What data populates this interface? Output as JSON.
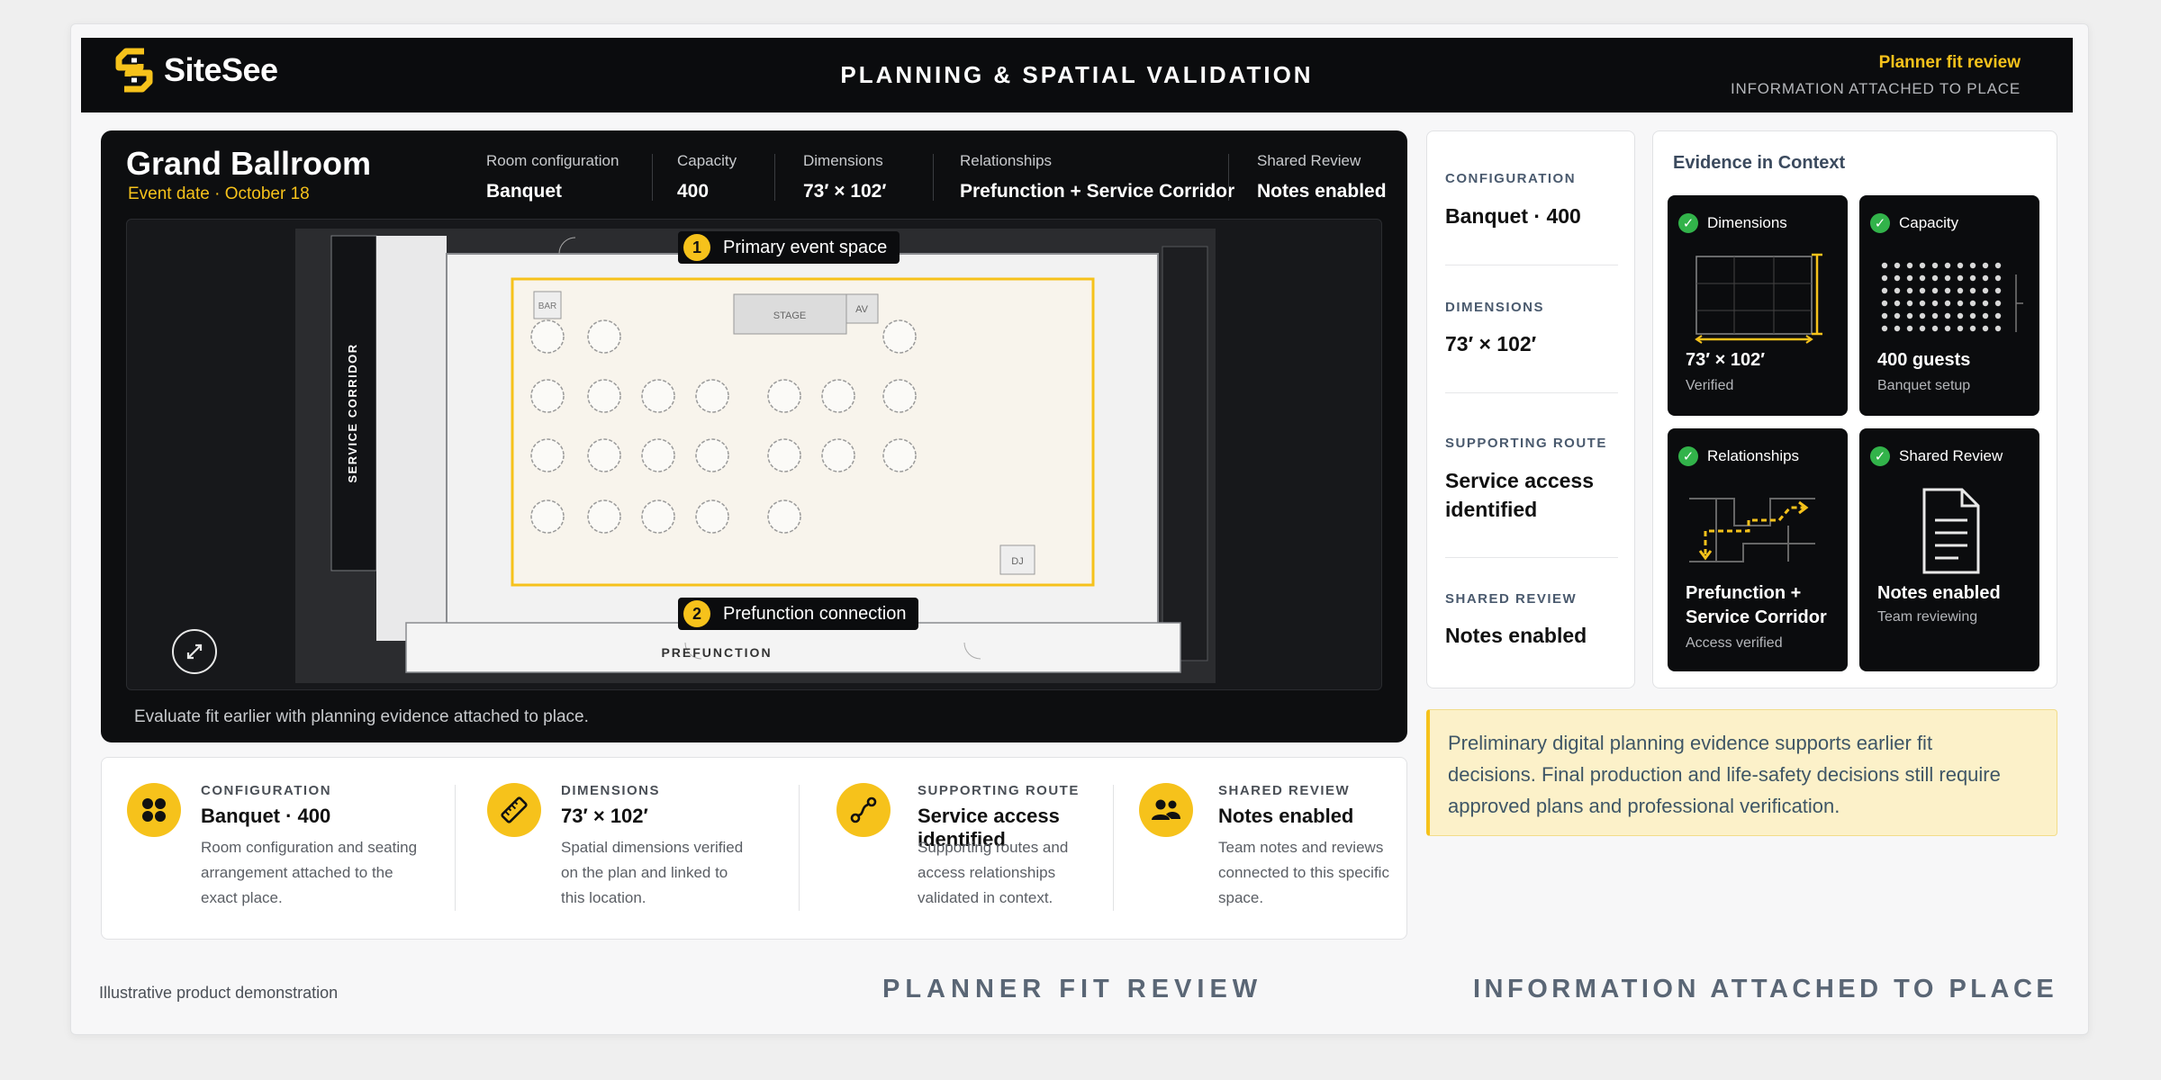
{
  "brand": {
    "name": "SiteSee",
    "accent": "#f6c21b"
  },
  "header": {
    "title": "PLANNING & SPATIAL VALIDATION",
    "right_title": "Planner fit review",
    "right_subtitle": "INFORMATION ATTACHED TO PLACE"
  },
  "room": {
    "name": "Grand Ballroom",
    "event_date": "Event date · October 18",
    "info": [
      {
        "label": "Room configuration",
        "value": "Banquet"
      },
      {
        "label": "Capacity",
        "value": "400"
      },
      {
        "label": "Dimensions",
        "value": "73′ × 102′"
      },
      {
        "label": "Relationships",
        "value": "Prefunction + Service Corridor"
      },
      {
        "label": "Shared Review",
        "value": "Notes enabled"
      }
    ],
    "callouts": [
      {
        "num": "1",
        "text": "Primary event space"
      },
      {
        "num": "2",
        "text": "Prefunction connection"
      }
    ],
    "plan_labels": {
      "service": "SERVICE CORRIDOR",
      "prefunction": "PREFUNCTION",
      "stage": "STAGE",
      "bar": "BAR",
      "av": "AV",
      "dj": "DJ"
    },
    "caption": "Evaluate fit earlier with planning evidence attached to place."
  },
  "summary": [
    {
      "icon": "grid-dots-icon",
      "label": "CONFIGURATION",
      "value": "Banquet · 400",
      "desc": [
        "Room configuration and seating",
        "arrangement attached to the",
        "exact place."
      ]
    },
    {
      "icon": "ruler-icon",
      "label": "DIMENSIONS",
      "value": "73′ × 102′",
      "desc": [
        "Spatial dimensions verified",
        "on the plan and linked to",
        "this location."
      ]
    },
    {
      "icon": "route-icon",
      "label": "SUPPORTING ROUTE",
      "value": "Service access identified",
      "desc": [
        "Supporting routes and",
        "access relationships",
        "validated in context."
      ]
    },
    {
      "icon": "people-icon",
      "label": "SHARED REVIEW",
      "value": "Notes enabled",
      "desc": [
        "Team notes and reviews",
        "connected to this specific",
        "space."
      ]
    }
  ],
  "side": [
    {
      "label": "CONFIGURATION",
      "value": "Banquet · 400"
    },
    {
      "label": "DIMENSIONS",
      "value": "73′ × 102′"
    },
    {
      "label": "SUPPORTING ROUTE",
      "value": "Service access identified"
    },
    {
      "label": "SHARED REVIEW",
      "value": "Notes enabled"
    }
  ],
  "evidence": {
    "title": "Evidence in Context",
    "tiles": [
      {
        "head": "Dimensions",
        "value": "73′ × 102′",
        "sub": "Verified"
      },
      {
        "head": "Capacity",
        "value": "400 guests",
        "sub": "Banquet setup"
      },
      {
        "head": "Relationships",
        "value": "Prefunction +",
        "value2": "Service Corridor",
        "sub": "Access verified"
      },
      {
        "head": "Shared Review",
        "value": "Notes enabled",
        "sub": "Team reviewing"
      }
    ]
  },
  "note": "Preliminary digital planning evidence supports earlier fit decisions. Final production and life-safety decisions still require approved plans and professional verification.",
  "footer": {
    "left": "Illustrative product demonstration",
    "middle": "PLANNER FIT REVIEW",
    "right": "INFORMATION ATTACHED TO PLACE"
  }
}
